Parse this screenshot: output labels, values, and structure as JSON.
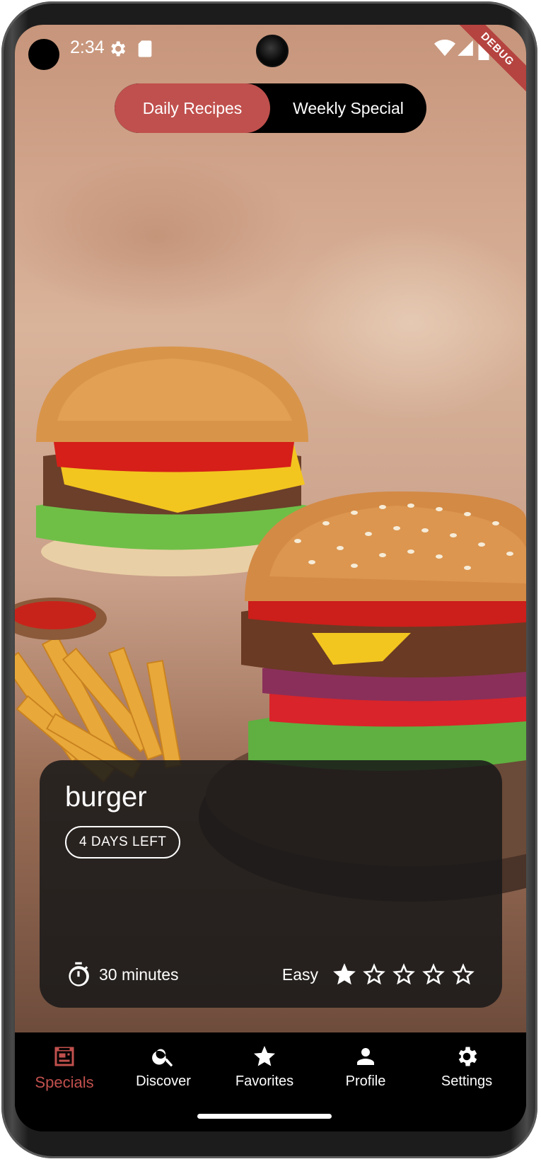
{
  "status_bar": {
    "time": "2:34",
    "icons": [
      "gear-icon",
      "sd-card-icon",
      "wifi-icon",
      "signal-icon",
      "battery-icon"
    ],
    "debug_banner": "DEBUG"
  },
  "toggle": {
    "active_label": "Daily Recipes",
    "inactive_label": "Weekly Special",
    "accent_color": "#c0504d"
  },
  "card": {
    "title": "burger",
    "badge": "4 DAYS LEFT",
    "duration": "30 minutes",
    "difficulty": "Easy",
    "rating": 1,
    "rating_max": 5
  },
  "nav": {
    "items": [
      {
        "label": "Specials",
        "icon": "specials-icon",
        "active": true
      },
      {
        "label": "Discover",
        "icon": "search-icon",
        "active": false
      },
      {
        "label": "Favorites",
        "icon": "star-icon",
        "active": false
      },
      {
        "label": "Profile",
        "icon": "person-icon",
        "active": false
      },
      {
        "label": "Settings",
        "icon": "gear-icon",
        "active": false
      }
    ]
  }
}
